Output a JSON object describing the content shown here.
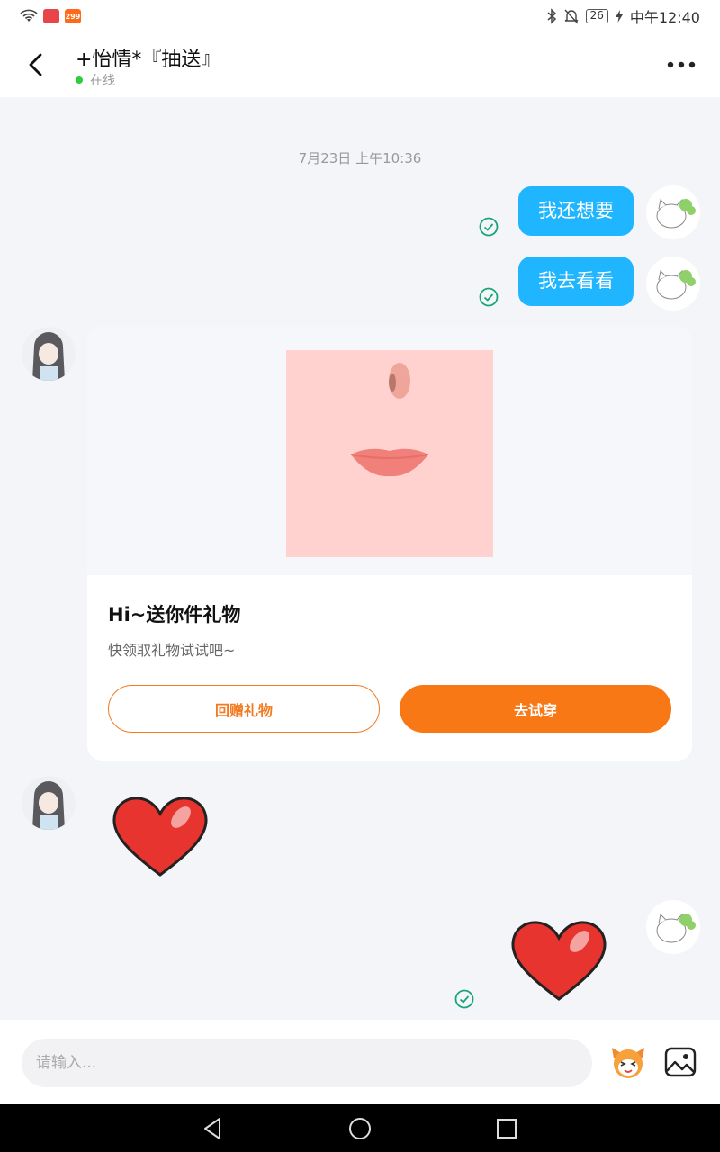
{
  "status_bar": {
    "time": "中午12:40",
    "battery": "26",
    "app_badge": "299",
    "icons": [
      "wifi-icon",
      "app-icon",
      "bluetooth-icon",
      "mute-icon",
      "charging-icon"
    ]
  },
  "header": {
    "title": "+怡情*『抽送』",
    "presence": "在线"
  },
  "chat": {
    "timestamp": "7月23日 上午10:36",
    "messages_out": [
      "我还想要",
      "我去看看"
    ],
    "gift_card": {
      "title": "Hi~送你件礼物",
      "subtitle": "快领取礼物试试吧~",
      "btn_return": "回赠礼物",
      "btn_try": "去试穿"
    }
  },
  "input_bar": {
    "placeholder": "请输入..."
  },
  "colors": {
    "accent_blue": "#1fb6ff",
    "accent_orange": "#f77815",
    "online_green": "#2ecc40",
    "read_check": "#17a673"
  }
}
